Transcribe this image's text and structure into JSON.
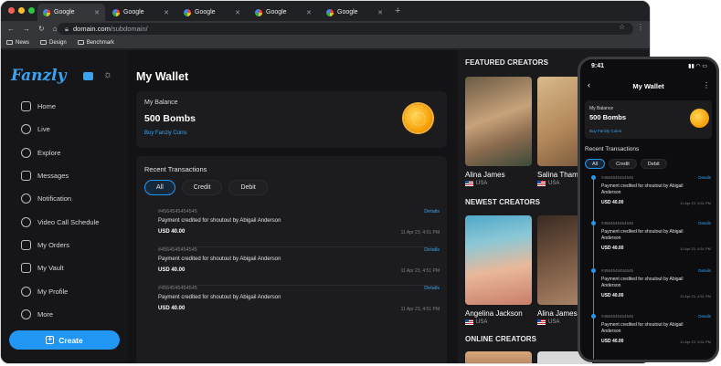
{
  "browser": {
    "tabs": [
      {
        "label": "Google",
        "active": true
      },
      {
        "label": "Google",
        "active": false
      },
      {
        "label": "Google",
        "active": false
      },
      {
        "label": "Google",
        "active": false
      },
      {
        "label": "Google",
        "active": false
      }
    ],
    "url_host": "domain.com",
    "url_path": "/subdomain/",
    "bookmarks": [
      "News",
      "Design",
      "Benchmark"
    ],
    "icons": {
      "back": "back-arrow-icon",
      "forward": "forward-arrow-icon",
      "reload": "reload-icon",
      "home": "home-icon",
      "lock": "lock-icon",
      "star": "star-icon",
      "menu": "kebab-menu-icon"
    }
  },
  "app": {
    "brand": "Fanzly",
    "brand_color": "#3aa3f0",
    "sidebar": {
      "items": [
        {
          "label": "Home",
          "icon": "home-icon"
        },
        {
          "label": "Live",
          "icon": "live-icon"
        },
        {
          "label": "Explore",
          "icon": "search-icon"
        },
        {
          "label": "Messages",
          "icon": "messages-icon"
        },
        {
          "label": "Notification",
          "icon": "bell-icon"
        },
        {
          "label": "Video Call Schedule",
          "icon": "video-call-icon"
        },
        {
          "label": "My Orders",
          "icon": "bag-icon"
        },
        {
          "label": "My Vault",
          "icon": "vault-icon"
        },
        {
          "label": "My Profile",
          "icon": "user-icon"
        },
        {
          "label": "More",
          "icon": "more-icon"
        }
      ],
      "create_label": "Create"
    },
    "main": {
      "title": "My Wallet",
      "balance": {
        "label": "My Balance",
        "value": "500 Bombs",
        "link": "Buy Fanzly Coins"
      },
      "transactions": {
        "title": "Recent Transactions",
        "filters": [
          "All",
          "Credit",
          "Debit"
        ],
        "active_filter": "All",
        "rows": [
          {
            "id": "#4564545454545",
            "details": "Details",
            "desc": "Payment credited for shoutout by Abigail Anderson",
            "amount": "USD 40.00",
            "date": "11 Apr 23, 4:51 PM"
          },
          {
            "id": "#4564545454545",
            "details": "Details",
            "desc": "Payment credited for shoutout by Abigail Anderson",
            "amount": "USD 40.00",
            "date": "11 Apr 23, 4:51 PM"
          },
          {
            "id": "#4564545454545",
            "details": "Details",
            "desc": "Payment credited for shoutout by Abigail Anderson",
            "amount": "USD 40.00",
            "date": "11 Apr 23, 4:51 PM"
          }
        ]
      }
    },
    "right": {
      "featured_title": "FEATURED CREATORS",
      "newest_title": "NEWEST CREATORS",
      "online_title": "ONLINE CREATORS",
      "featured": [
        {
          "name": "Alina James",
          "country": "USA"
        },
        {
          "name": "Salina Thampson",
          "country": "USA"
        }
      ],
      "newest": [
        {
          "name": "Angelina Jackson",
          "country": "USA"
        },
        {
          "name": "Alina James",
          "country": "USA"
        }
      ]
    }
  },
  "phone": {
    "time": "9:41",
    "title": "My Wallet",
    "balance": {
      "label": "My Balance",
      "value": "500 Bombs",
      "link": "Buy Fanzly Coins"
    },
    "transactions_title": "Recent Transactions",
    "filters": [
      "All",
      "Credit",
      "Debit"
    ],
    "rows": [
      {
        "id": "#4564545454545",
        "details": "Details",
        "desc": "Payment credited for shoutout by Abigail Anderson",
        "amount": "USD 40.00",
        "date": "11 Apr 23, 4:51 PM"
      },
      {
        "id": "#4564545454545",
        "details": "Details",
        "desc": "Payment credited for shoutout by Abigail Anderson",
        "amount": "USD 40.00",
        "date": "11 Apr 23, 4:51 PM"
      },
      {
        "id": "#4564545454545",
        "details": "Details",
        "desc": "Payment credited for shoutout by Abigail Anderson",
        "amount": "USD 40.00",
        "date": "11 Apr 23, 4:51 PM"
      },
      {
        "id": "#4564545454545",
        "details": "Details",
        "desc": "Payment credited for shoutout by Abigail Anderson",
        "amount": "USD 40.00",
        "date": "11 Apr 23, 4:51 PM"
      }
    ]
  }
}
